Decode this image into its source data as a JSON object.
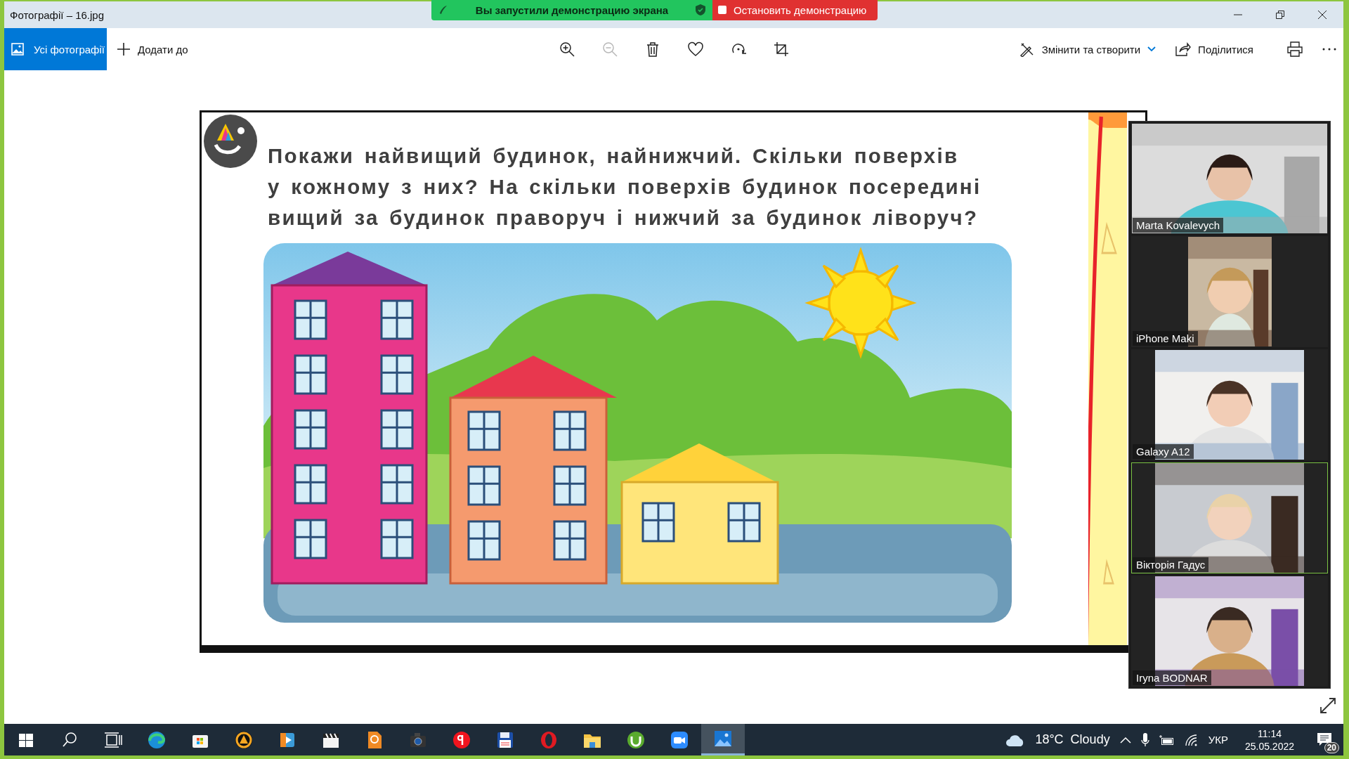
{
  "window": {
    "title": "Фотографії – 16.jpg"
  },
  "screen_share": {
    "status": "Вы запустили демонстрацию экрана",
    "stop_button": "Остановить демонстрацию"
  },
  "toolbar": {
    "all_photos": "Усі фотографії",
    "add_to": "Додати до",
    "tools": [
      {
        "kind": "zoom_in",
        "disabled": false
      },
      {
        "kind": "zoom_out",
        "disabled": true
      },
      {
        "kind": "delete",
        "disabled": false
      },
      {
        "kind": "favorite",
        "disabled": false
      },
      {
        "kind": "rotate",
        "disabled": false
      },
      {
        "kind": "crop",
        "disabled": false
      }
    ],
    "edit_create": "Змінити та створити",
    "share": "Поділитися"
  },
  "slide": {
    "lines": [
      "Покажи найвищий будинок, найнижчий. Скільки поверхів",
      "у кожному з них? На скільки поверхів будинок посередині",
      "вищий за будинок праворуч і нижчий за будинок ліворуч?"
    ]
  },
  "participants": [
    {
      "name": "Marta Kovalevych",
      "speaking": false
    },
    {
      "name": "iPhone Maki",
      "speaking": false
    },
    {
      "name": "Galaxy A12",
      "speaking": false
    },
    {
      "name": "Вікторія Гадус",
      "speaking": true
    },
    {
      "name": "Iryna BODNAR",
      "speaking": false
    }
  ],
  "taskbar": {
    "apps": [
      {
        "kind": "start",
        "active": false
      },
      {
        "kind": "search",
        "active": false
      },
      {
        "kind": "taskview",
        "active": false
      },
      {
        "kind": "browser",
        "active": false
      },
      {
        "kind": "store",
        "active": false
      },
      {
        "kind": "player",
        "active": false
      },
      {
        "kind": "media",
        "active": false
      },
      {
        "kind": "clapper",
        "active": false
      },
      {
        "kind": "pdf",
        "active": false
      },
      {
        "kind": "camera",
        "active": false
      },
      {
        "kind": "yandex",
        "active": false
      },
      {
        "kind": "floppy",
        "active": false
      },
      {
        "kind": "opera",
        "active": false
      },
      {
        "kind": "folder",
        "active": false
      },
      {
        "kind": "torrent",
        "active": false
      },
      {
        "kind": "video",
        "active": false
      },
      {
        "kind": "photos",
        "active": true
      }
    ],
    "temperature": "18°C",
    "weather": "Cloudy",
    "language": "УКР",
    "time": "11:14",
    "date": "25.05.2022",
    "notifications": "20"
  }
}
